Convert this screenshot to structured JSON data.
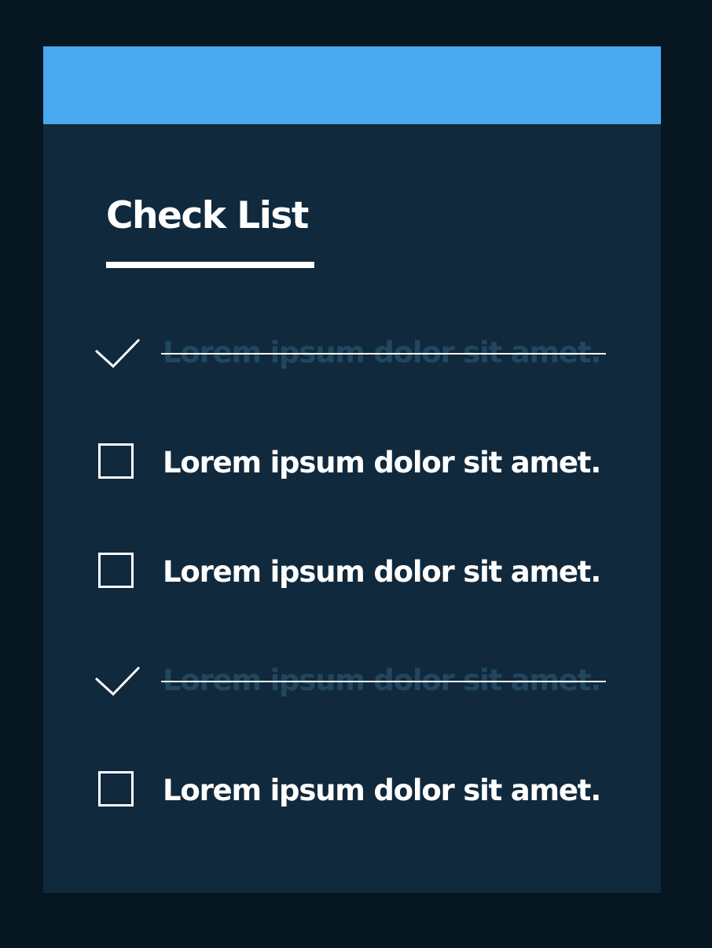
{
  "checklist": {
    "title": "Check List",
    "items": [
      {
        "label": "Lorem ipsum dolor sit amet.",
        "checked": true
      },
      {
        "label": "Lorem ipsum dolor sit amet.",
        "checked": false
      },
      {
        "label": "Lorem ipsum dolor sit amet.",
        "checked": false
      },
      {
        "label": "Lorem ipsum dolor sit amet.",
        "checked": true
      },
      {
        "label": "Lorem ipsum dolor sit amet.",
        "checked": false
      }
    ]
  },
  "colors": {
    "page_background": "#071722",
    "card_background": "#10293d",
    "header_accent": "#49a8ef",
    "text": "#ffffff",
    "completed_text": "#21475f"
  }
}
